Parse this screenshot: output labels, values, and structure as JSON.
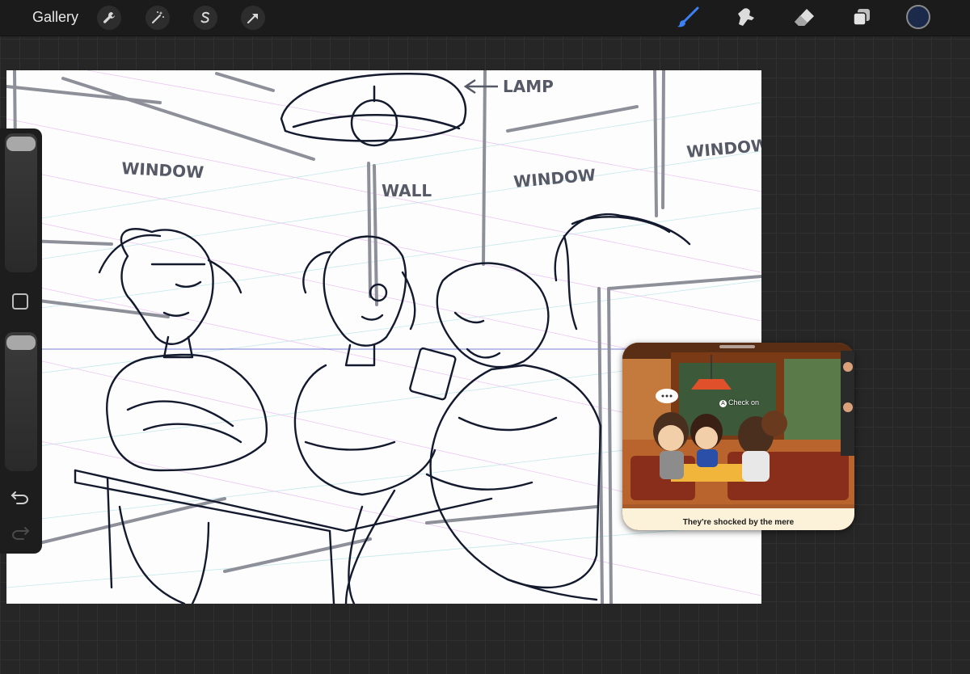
{
  "topbar": {
    "gallery_label": "Gallery",
    "actions": [
      {
        "name": "adjustments",
        "icon": "wrench-icon"
      },
      {
        "name": "adjust-effects",
        "icon": "magic-wand-icon"
      },
      {
        "name": "selection",
        "icon": "selection-s-icon"
      },
      {
        "name": "transform",
        "icon": "arrow-cursor-icon"
      }
    ],
    "tools": [
      {
        "name": "brush",
        "icon": "brush-icon",
        "active": true
      },
      {
        "name": "smudge",
        "icon": "smudge-icon",
        "active": false
      },
      {
        "name": "eraser",
        "icon": "eraser-icon",
        "active": false
      },
      {
        "name": "layers",
        "icon": "layers-icon",
        "active": false
      }
    ],
    "current_color": "#1b2a4a",
    "accent_color": "#3b82f6"
  },
  "sidebar": {
    "brush_size_level": 0.05,
    "opacity_level": 0.05,
    "undo_icon": "undo-icon",
    "redo_icon": "redo-icon",
    "modify_icon": "square-modify-icon"
  },
  "canvas": {
    "labels": {
      "lamp": "LAMP",
      "window_left": "WINDOW",
      "wall": "WALL",
      "window_center": "WINDOW",
      "window_right": "WINDOW"
    },
    "ink_color": "#141a2e"
  },
  "pip": {
    "prompt": "Check on",
    "button_glyph": "A",
    "caption": "They're shocked by the mere"
  }
}
